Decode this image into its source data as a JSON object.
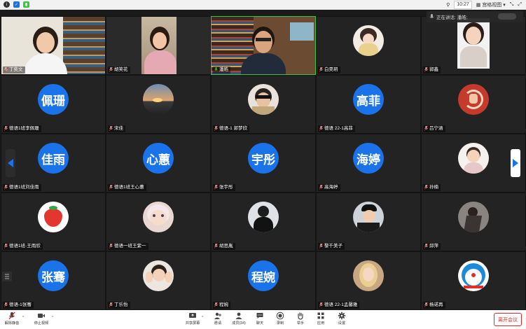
{
  "topbar": {
    "time": "10:27",
    "view_label": "宫格视图",
    "colors": {
      "info": "#333333",
      "shield": "#1a73e8",
      "signal": "#3ec43e"
    }
  },
  "speaking": {
    "label": "正在讲话: 潘皓;"
  },
  "tiles": [
    {
      "name": "丁奕文",
      "kind": "video",
      "scene": "girl-books"
    },
    {
      "name": "胡笑花",
      "kind": "video",
      "scene": "girl-room"
    },
    {
      "name": "潘皓",
      "kind": "video",
      "scene": "man-books",
      "active": true
    },
    {
      "name": "白昊玥",
      "kind": "avatar",
      "scene": "doll"
    },
    {
      "name": "郭鑫",
      "kind": "avatar-sq",
      "scene": "girl-photo"
    },
    {
      "name": "德语1班李佩珊",
      "kind": "text",
      "circle": "佩珊"
    },
    {
      "name": "宋佳",
      "kind": "avatar",
      "scene": "sunset"
    },
    {
      "name": "德语-1 郭梦欣",
      "kind": "avatar",
      "scene": "sunglasses"
    },
    {
      "name": "德语 22-1高菲",
      "kind": "text",
      "circle": "高菲"
    },
    {
      "name": "吕宁涵",
      "kind": "avatar",
      "scene": "red-art"
    },
    {
      "name": "德语1班刘佳雨",
      "kind": "text",
      "circle": "佳雨"
    },
    {
      "name": "德语1班王心蕙",
      "kind": "text",
      "circle": "心蕙"
    },
    {
      "name": "张宇彤",
      "kind": "text",
      "circle": "宇彤"
    },
    {
      "name": "高海婷",
      "kind": "text",
      "circle": "海婷"
    },
    {
      "name": "孙楠",
      "kind": "avatar",
      "scene": "baby"
    },
    {
      "name": "德语1班-王雨欣",
      "kind": "avatar",
      "scene": "strawberry"
    },
    {
      "name": "德语一班王紫一",
      "kind": "avatar",
      "scene": "anime-girl"
    },
    {
      "name": "胡思胤",
      "kind": "avatar",
      "scene": "dark-person"
    },
    {
      "name": "黎千美子",
      "kind": "avatar",
      "scene": "uniform"
    },
    {
      "name": "邱萍",
      "kind": "avatar",
      "scene": "dancer"
    },
    {
      "name": "德语-1张骞",
      "kind": "text",
      "circle": "张骞"
    },
    {
      "name": "丁乐怡",
      "kind": "avatar",
      "scene": "hands-face"
    },
    {
      "name": "程婉",
      "kind": "text",
      "circle": "程婉"
    },
    {
      "name": "德语 22-1孟馨雅",
      "kind": "avatar",
      "scene": "blonde"
    },
    {
      "name": "杨诺再",
      "kind": "avatar",
      "scene": "doraemon"
    }
  ],
  "toolbar": {
    "unmute": "解除静音",
    "stop_video": "停止视频",
    "share": "共享屏幕",
    "invite": "邀请",
    "members": "成员(34)",
    "chat": "聊天",
    "record": "录制",
    "raise_hand": "举手",
    "apps": "应用",
    "settings": "设置",
    "leave": "离开会议"
  }
}
